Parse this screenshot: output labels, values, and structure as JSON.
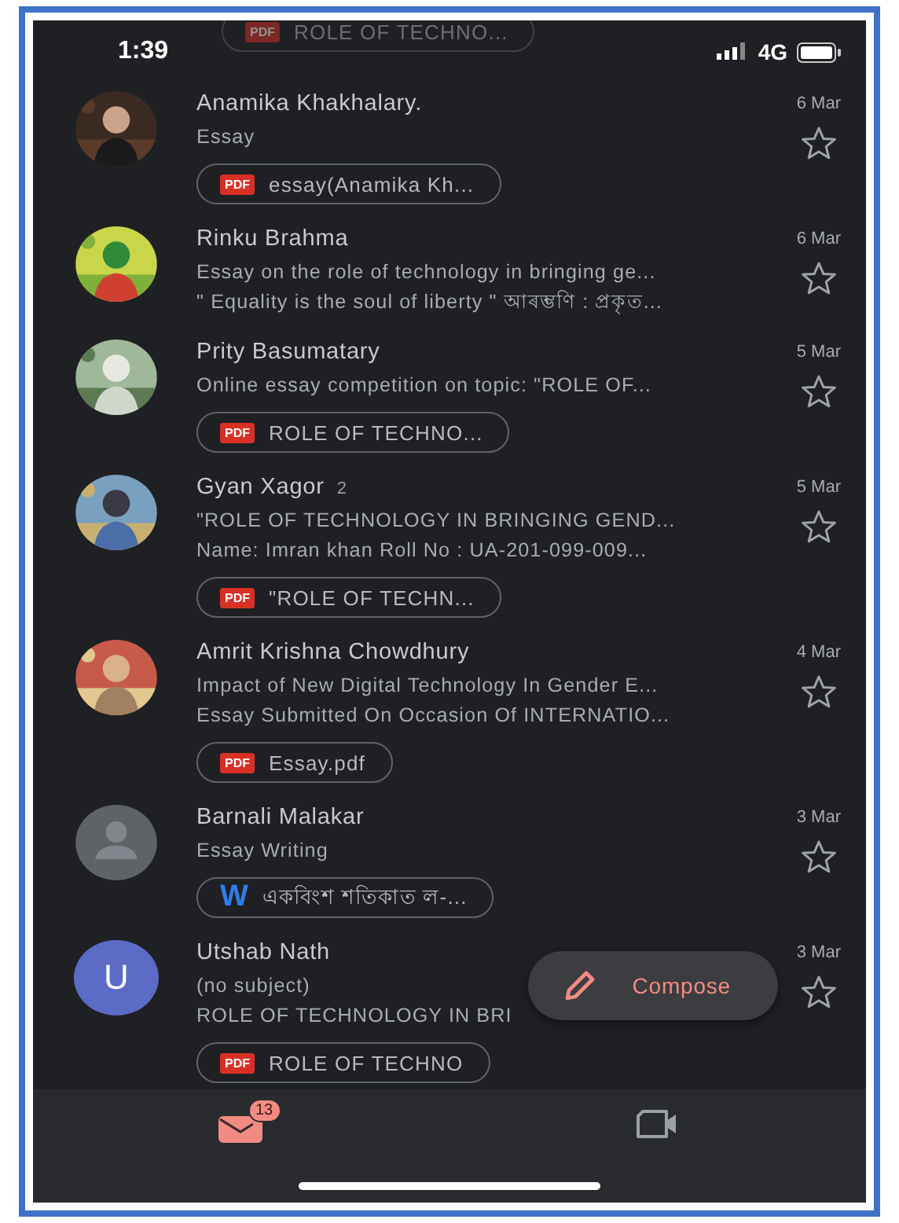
{
  "status_bar": {
    "time": "1:39",
    "network": "4G"
  },
  "scrolled_attachment": {
    "kind": "pdf",
    "icon_text": "PDF",
    "name": "ROLE OF TECHNO..."
  },
  "emails": [
    {
      "sender": "Anamika Khakhalary.",
      "date": "6 Mar",
      "avatar": {
        "kind": "picture"
      },
      "lines": [
        "Essay"
      ],
      "starred": false,
      "attachment": {
        "kind": "pdf",
        "icon_text": "PDF",
        "name": "essay(Anamika Kh..."
      }
    },
    {
      "sender": "Rinku Brahma",
      "date": "6 Mar",
      "avatar": {
        "kind": "picture"
      },
      "lines": [
        "Essay on the role of technology in bringing ge...",
        "\" Equality is the soul of liberty \" আৰম্ভণি : প্ৰকৃত..."
      ],
      "starred": false
    },
    {
      "sender": "Prity Basumatary",
      "date": "5 Mar",
      "avatar": {
        "kind": "picture"
      },
      "lines": [
        "Online essay competition on topic: \"ROLE OF..."
      ],
      "starred": false,
      "attachment": {
        "kind": "pdf",
        "icon_text": "PDF",
        "name": "ROLE OF TECHNO..."
      }
    },
    {
      "sender": "Gyan Xagor",
      "count": "2",
      "date": "5 Mar",
      "avatar": {
        "kind": "picture"
      },
      "lines": [
        "\"ROLE OF TECHNOLOGY IN BRINGING GEND...",
        "Name: Imran khan Roll No : UA-201-099-009..."
      ],
      "starred": false,
      "attachment": {
        "kind": "pdf",
        "icon_text": "PDF",
        "name": "\"ROLE OF TECHN..."
      }
    },
    {
      "sender": "Amrit Krishna Chowdhury",
      "date": "4 Mar",
      "avatar": {
        "kind": "picture"
      },
      "lines": [
        "Impact of New Digital Technology In Gender E...",
        "Essay Submitted On Occasion Of INTERNATIO..."
      ],
      "starred": false,
      "attachment": {
        "kind": "pdf",
        "icon_text": "PDF",
        "name": "Essay.pdf"
      }
    },
    {
      "sender": "Barnali Malakar",
      "date": "3 Mar",
      "avatar": {
        "kind": "placeholder"
      },
      "lines": [
        "Essay Writing"
      ],
      "starred": false,
      "attachment": {
        "kind": "word",
        "icon_text": "W",
        "name": "একবিংশ শতিকাত ল-..."
      }
    },
    {
      "sender": "Utshab Nath",
      "date": "3 Mar",
      "avatar": {
        "kind": "letter",
        "letter": "U",
        "color": "#5b6bc6"
      },
      "lines": [
        "(no subject)",
        "ROLE OF TECHNOLOGY IN BRI"
      ],
      "starred": false,
      "attachment": {
        "kind": "pdf",
        "icon_text": "PDF",
        "name": "ROLE OF TECHNO"
      }
    }
  ],
  "compose": {
    "label": "Compose"
  },
  "nav": [
    {
      "kind": "mail",
      "selected": true,
      "badge": "13"
    },
    {
      "kind": "meet",
      "selected": false
    }
  ]
}
